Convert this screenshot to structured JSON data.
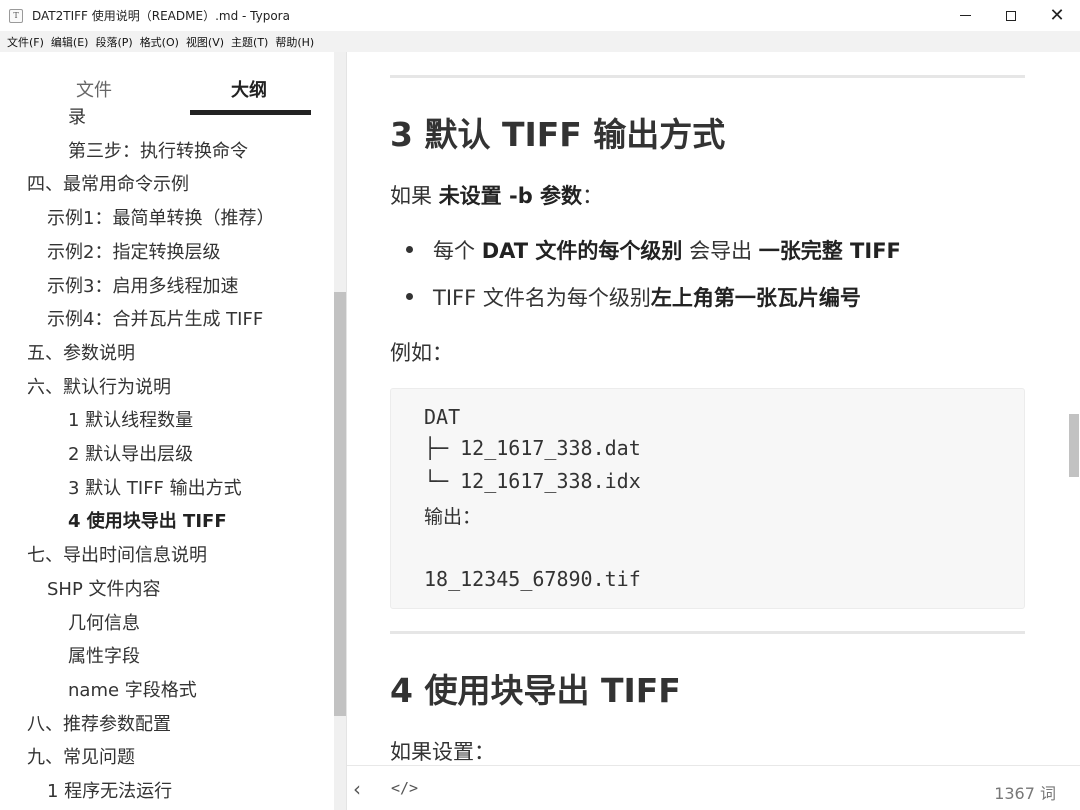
{
  "window": {
    "app_icon_letter": "T",
    "title": "DAT2TIFF 使用说明（README）.md - Typora",
    "close_glyph": "✕"
  },
  "menu": [
    "文件(F)",
    "编辑(E)",
    "段落(P)",
    "格式(O)",
    "视图(V)",
    "主题(T)",
    "帮助(H)"
  ],
  "sidebar": {
    "tabs": {
      "files": "文件",
      "outline": "大纲"
    },
    "outline": [
      {
        "label": "录",
        "level": 3,
        "active": false
      },
      {
        "label": "第三步：执行转换命令",
        "level": 3,
        "active": false
      },
      {
        "label": "四、最常用命令示例",
        "level": 1,
        "active": false
      },
      {
        "label": "示例1：最简单转换（推荐）",
        "level": 2,
        "active": false
      },
      {
        "label": "示例2：指定转换层级",
        "level": 2,
        "active": false
      },
      {
        "label": "示例3：启用多线程加速",
        "level": 2,
        "active": false
      },
      {
        "label": "示例4：合并瓦片生成 TIFF",
        "level": 2,
        "active": false
      },
      {
        "label": "五、参数说明",
        "level": 1,
        "active": false
      },
      {
        "label": "六、默认行为说明",
        "level": 1,
        "active": false
      },
      {
        "label": "1 默认线程数量",
        "level": 3,
        "active": false
      },
      {
        "label": "2 默认导出层级",
        "level": 3,
        "active": false
      },
      {
        "label": "3 默认 TIFF 输出方式",
        "level": 3,
        "active": false
      },
      {
        "label": "4 使用块导出 TIFF",
        "level": 3,
        "active": true
      },
      {
        "label": "七、导出时间信息说明",
        "level": 1,
        "active": false
      },
      {
        "label": "SHP 文件内容",
        "level": 2,
        "active": false
      },
      {
        "label": "几何信息",
        "level": 3,
        "active": false
      },
      {
        "label": "属性字段",
        "level": 3,
        "active": false
      },
      {
        "label": "name 字段格式",
        "level": 3,
        "active": false
      },
      {
        "label": "八、推荐参数配置",
        "level": 1,
        "active": false
      },
      {
        "label": "九、常见问题",
        "level": 1,
        "active": false
      },
      {
        "label": "1 程序无法运行",
        "level": 2,
        "active": false
      }
    ]
  },
  "content": {
    "h3_default": "3 默认 TIFF 输出方式",
    "p_if_prefix": "如果 ",
    "p_if_bold": "未设置 -b 参数",
    "p_if_suffix": "：",
    "bullet1": {
      "t1": "每个 ",
      "b1": "DAT 文件的每个级别",
      "t2": " 会导出 ",
      "b2": "一张完整 TIFF"
    },
    "bullet2": {
      "t1": "TIFF 文件名为每个级别",
      "b1": "左上角第一张瓦片编号"
    },
    "p_example": "例如：",
    "code": {
      "l1": "DAT",
      "l2": "├─ 12_1617_338.dat",
      "l3": "└─ 12_1617_338.idx",
      "l4": "输出：",
      "l5": "18_12345_67890.tif"
    },
    "h3_block": "4 使用块导出 TIFF",
    "p_if_set": "如果设置："
  },
  "footer": {
    "back_glyph": "‹",
    "code_glyph": "</>",
    "word_count": "1367 词"
  }
}
